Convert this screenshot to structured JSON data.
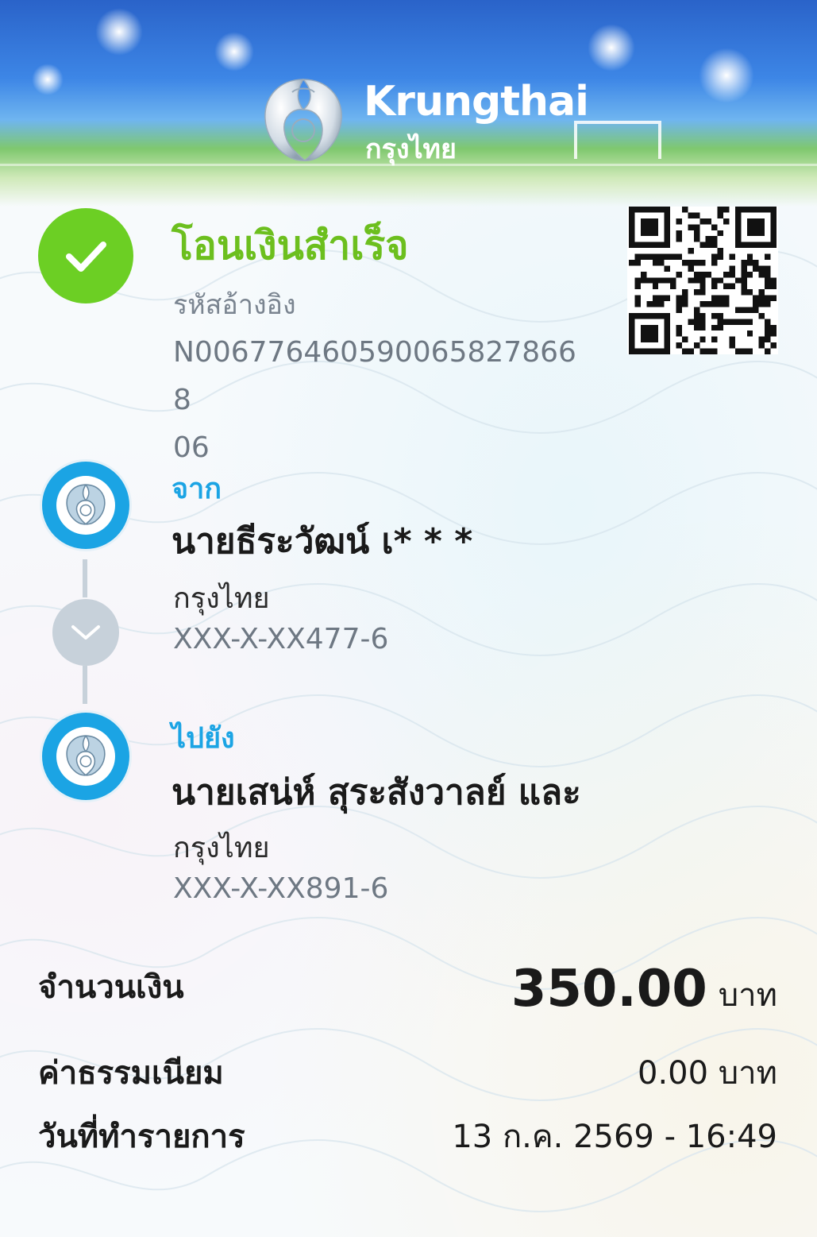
{
  "header": {
    "brand_en": "Krungthai",
    "brand_th": "กรุงไทย"
  },
  "status": {
    "title": "โอนเงินสำเร็จ",
    "ref_label": "รหัสอ้างอิง",
    "ref_value": "N00677646059006582786680 6",
    "ref_line1": "N0067764605900658278668",
    "ref_line2": "06"
  },
  "from": {
    "label": "จาก",
    "name": "นายธีระวัฒน์ เ* * *",
    "bank": "กรุงไทย",
    "account": "XXX-X-XX477-6"
  },
  "to": {
    "label": "ไปยัง",
    "name": "นายเสน่ห์ สุระสังวาลย์ และ",
    "bank": "กรุงไทย",
    "account": "XXX-X-XX891-6"
  },
  "summary": {
    "amount_label": "จำนวนเงิน",
    "amount_value": "350.00",
    "amount_unit": "บาท",
    "fee_label": "ค่าธรรมเนียม",
    "fee_value": "0.00 บาท",
    "date_label": "วันที่ทำรายการ",
    "date_value": "13 ก.ค. 2569 - 16:49"
  },
  "colors": {
    "success_green": "#6ccf24",
    "accent_blue": "#1ba4e4",
    "muted_gray": "#6e7883"
  },
  "icons": {
    "success": "checkmark-icon",
    "bank_logo": "krungthai-bird-icon",
    "arrow": "chevron-down-icon"
  }
}
